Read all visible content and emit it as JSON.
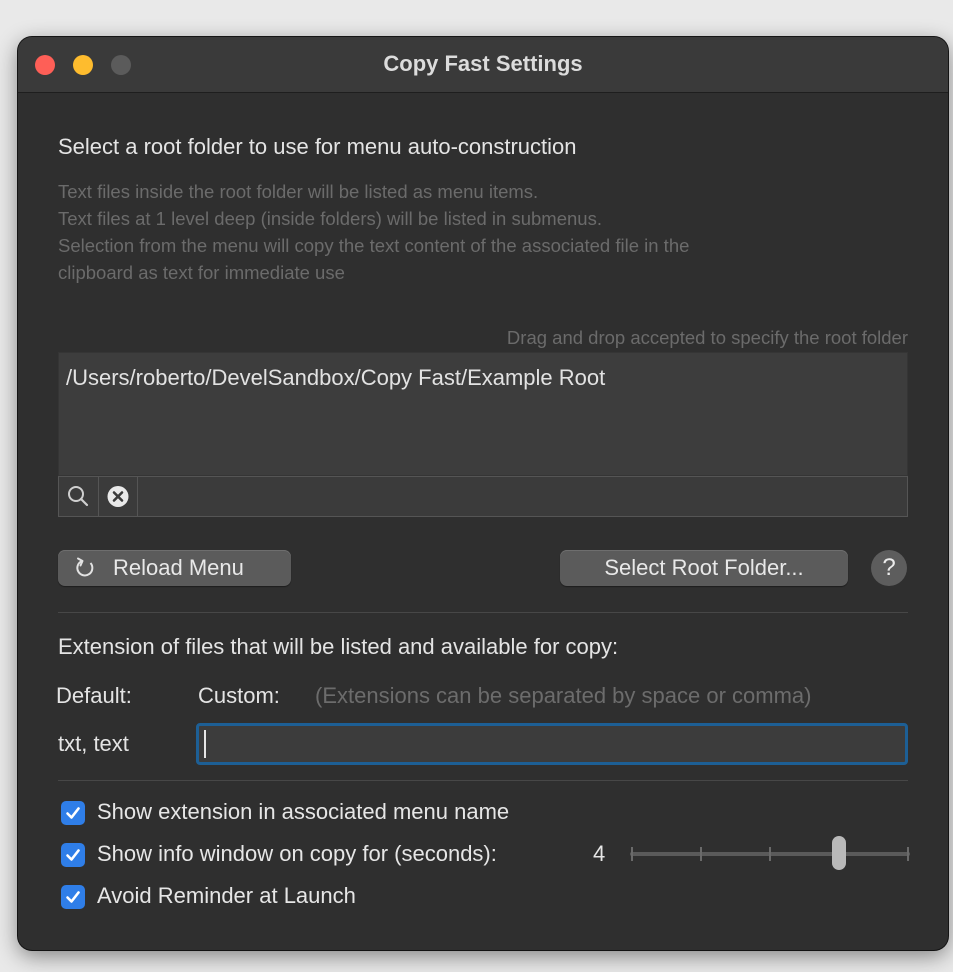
{
  "window": {
    "title": "Copy Fast Settings"
  },
  "root_section": {
    "heading": "Select a root folder to use for menu auto-construction",
    "description": [
      "Text files inside the root folder will be listed as menu items.",
      "Text files at 1 level deep (inside folders) will be listed in submenus.",
      "Selection from the menu will copy the text content of the associated file in the",
      "clipboard as text for immediate use"
    ],
    "drag_drop_hint": "Drag and drop accepted to specify the root folder",
    "path_value": "/Users/roberto/DevelSandbox/Copy Fast/Example Root"
  },
  "path_bar": {
    "icons": [
      "search-icon",
      "clear-icon"
    ]
  },
  "buttons": {
    "reload_label": "Reload Menu",
    "select_root_label": "Select Root Folder...",
    "help_label": "?"
  },
  "extensions": {
    "heading": "Extension of files that will be listed and available for copy:",
    "default_label": "Default:",
    "custom_label": "Custom:",
    "custom_hint": "(Extensions can be separated by space or comma)",
    "default_value": "txt, text",
    "custom_value": ""
  },
  "options": {
    "show_extension": {
      "label": "Show extension in associated menu name",
      "checked": true
    },
    "show_info": {
      "label": "Show info window on copy for (seconds):",
      "checked": true,
      "value": "4"
    },
    "avoid_reminder": {
      "label": "Avoid Reminder at Launch",
      "checked": true
    }
  },
  "slider": {
    "value": 4,
    "min": 1,
    "max": 5
  },
  "colors": {
    "accent": "#2f7ee8",
    "focus_ring": "#1d5f95",
    "window_bg": "#2f2f2f"
  }
}
